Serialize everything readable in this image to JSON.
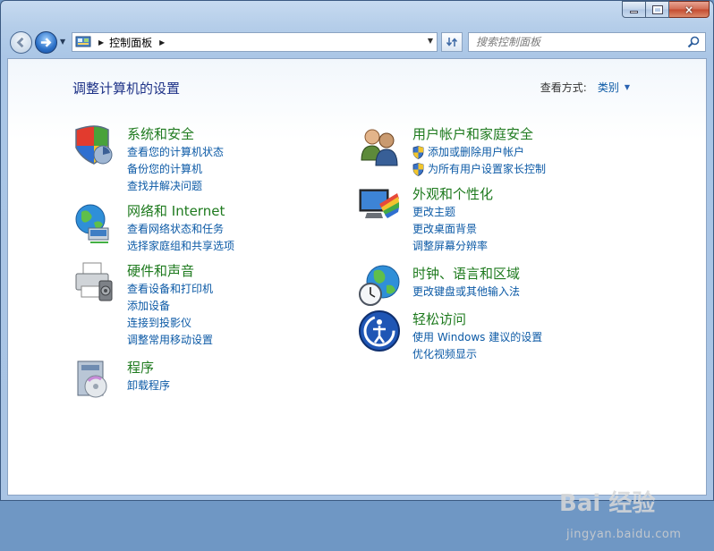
{
  "window": {
    "caption_buttons": {
      "minimize": "minimize",
      "maximize": "maximize",
      "close": "×"
    }
  },
  "address_bar": {
    "breadcrumbs": [
      "控制面板"
    ]
  },
  "search": {
    "placeholder": "搜索控制面板"
  },
  "content": {
    "title": "调整计算机的设置",
    "view_by": {
      "label": "查看方式:",
      "value": "类别"
    },
    "categories_left": [
      {
        "icon": "shield-icon",
        "title": "系统和安全",
        "links": [
          "查看您的计算机状态",
          "备份您的计算机",
          "查找并解决问题"
        ]
      },
      {
        "icon": "network-globe-icon",
        "title": "网络和 Internet",
        "links": [
          "查看网络状态和任务",
          "选择家庭组和共享选项"
        ]
      },
      {
        "icon": "printer-icon",
        "title": "硬件和声音",
        "links": [
          "查看设备和打印机",
          "添加设备",
          "连接到投影仪",
          "调整常用移动设置"
        ]
      },
      {
        "icon": "programs-icon",
        "title": "程序",
        "links": [
          "卸载程序"
        ]
      }
    ],
    "categories_right": [
      {
        "icon": "users-icon",
        "title": "用户帐户和家庭安全",
        "links": [
          "添加或删除用户帐户",
          "为所有用户设置家长控制"
        ],
        "shield_links": true
      },
      {
        "icon": "appearance-icon",
        "title": "外观和个性化",
        "links": [
          "更改主题",
          "更改桌面背景",
          "调整屏幕分辨率"
        ]
      },
      {
        "icon": "clock-globe-icon",
        "title": "时钟、语言和区域",
        "links": [
          "更改键盘或其他输入法"
        ]
      },
      {
        "icon": "ease-of-access-icon",
        "title": "轻松访问",
        "links": [
          "使用 Windows 建议的设置",
          "优化视频显示"
        ]
      }
    ]
  },
  "watermark": {
    "brand": "Bai 经验",
    "url": "jingyan.baidu.com"
  },
  "colors": {
    "link": "#0c5aa6",
    "category_title": "#1e7a1e",
    "page_title": "#1e3287",
    "frame": "#aac6e6"
  }
}
